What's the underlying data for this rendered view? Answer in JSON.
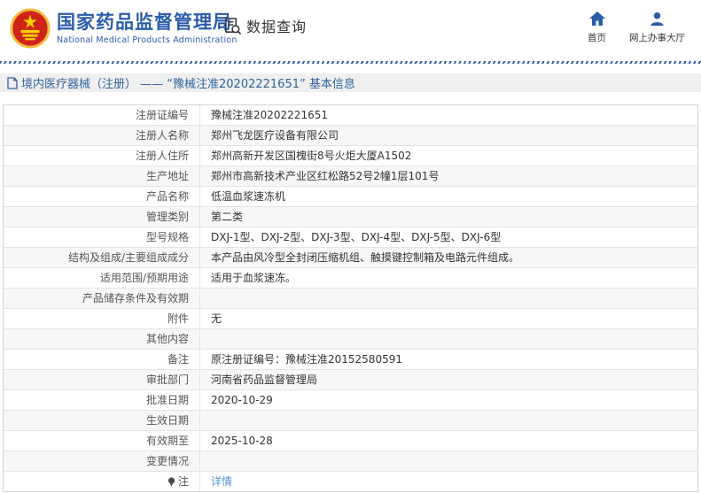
{
  "header": {
    "logo": {
      "emblem_icon": "china-national-emblem",
      "title_cn": "国家药品监督管理局",
      "title_en": "National Medical Products Administration"
    },
    "data_query_label": "数据查询",
    "nav": [
      {
        "label": "首页",
        "icon": "home-icon"
      },
      {
        "label": "网上办事大厅",
        "icon": "user-icon"
      }
    ]
  },
  "breadcrumb": {
    "icon": "document-icon",
    "text": "境内医疗器械（注册） —— “豫械注准20202221651” 基本信息"
  },
  "table": {
    "rows": [
      {
        "label": "注册证编号",
        "value": "豫械注准20202221651"
      },
      {
        "label": "注册人名称",
        "value": "郑州飞龙医疗设备有限公司"
      },
      {
        "label": "注册人住所",
        "value": "郑州高新开发区国槐街8号火炬大厦A1502"
      },
      {
        "label": "生产地址",
        "value": "郑州市高新技术产业区红松路52号2幢1层101号"
      },
      {
        "label": "产品名称",
        "value": "低温血浆速冻机"
      },
      {
        "label": "管理类别",
        "value": "第二类"
      },
      {
        "label": "型号规格",
        "value": "DXJ-1型、DXJ-2型、DXJ-3型、DXJ-4型、DXJ-5型、DXJ-6型"
      },
      {
        "label": "结构及组成/主要组成成分",
        "value": "本产品由风冷型全封闭压缩机组、触摸键控制箱及电路元件组成。"
      },
      {
        "label": "适用范围/预期用途",
        "value": "适用于血浆速冻。"
      },
      {
        "label": "产品储存条件及有效期",
        "value": ""
      },
      {
        "label": "附件",
        "value": "无"
      },
      {
        "label": "其他内容",
        "value": ""
      },
      {
        "label": "备注",
        "value": "原注册证编号：豫械注准20152580591"
      },
      {
        "label": "审批部门",
        "value": "河南省药品监督管理局"
      },
      {
        "label": "批准日期",
        "value": "2020-10-29"
      },
      {
        "label": "生效日期",
        "value": ""
      },
      {
        "label": "有效期至",
        "value": "2025-10-28"
      },
      {
        "label": "变更情况",
        "value": ""
      },
      {
        "label": "注",
        "value": "详情",
        "value_is_link": true,
        "label_icon": "note-pin-icon"
      }
    ]
  },
  "colors": {
    "brand_blue": "#2a5caa",
    "link_blue": "#4f92d1",
    "row_alt_bg": "#f7f7f7",
    "breadcrumb_text": "#31639c"
  }
}
